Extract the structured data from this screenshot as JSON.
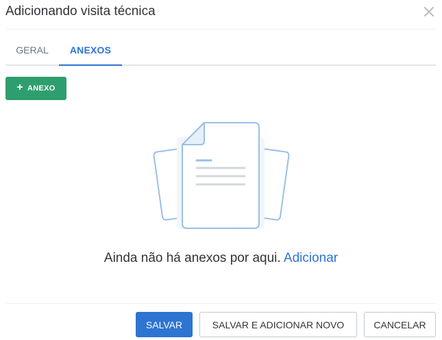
{
  "modal": {
    "title": "Adicionando visita técnica"
  },
  "tabs": [
    {
      "label": "GERAL",
      "active": false
    },
    {
      "label": "ANEXOS",
      "active": true
    }
  ],
  "toolbar": {
    "add_annex_label": "ANEXO",
    "add_annex_icon": "plus-icon"
  },
  "empty_state": {
    "message": "Ainda não há anexos por aqui.",
    "link": "Adicionar",
    "illustration_icon": "document-stack-icon"
  },
  "footer": {
    "save_label": "SALVAR",
    "save_new_label": "SALVAR E ADICIONAR NOVO",
    "cancel_label": "CANCELAR"
  },
  "colors": {
    "primary": "#2e74d1",
    "success": "#2f9e6e",
    "illustration_stroke": "#9bbfe6",
    "illustration_fill": "#eef5fc"
  }
}
